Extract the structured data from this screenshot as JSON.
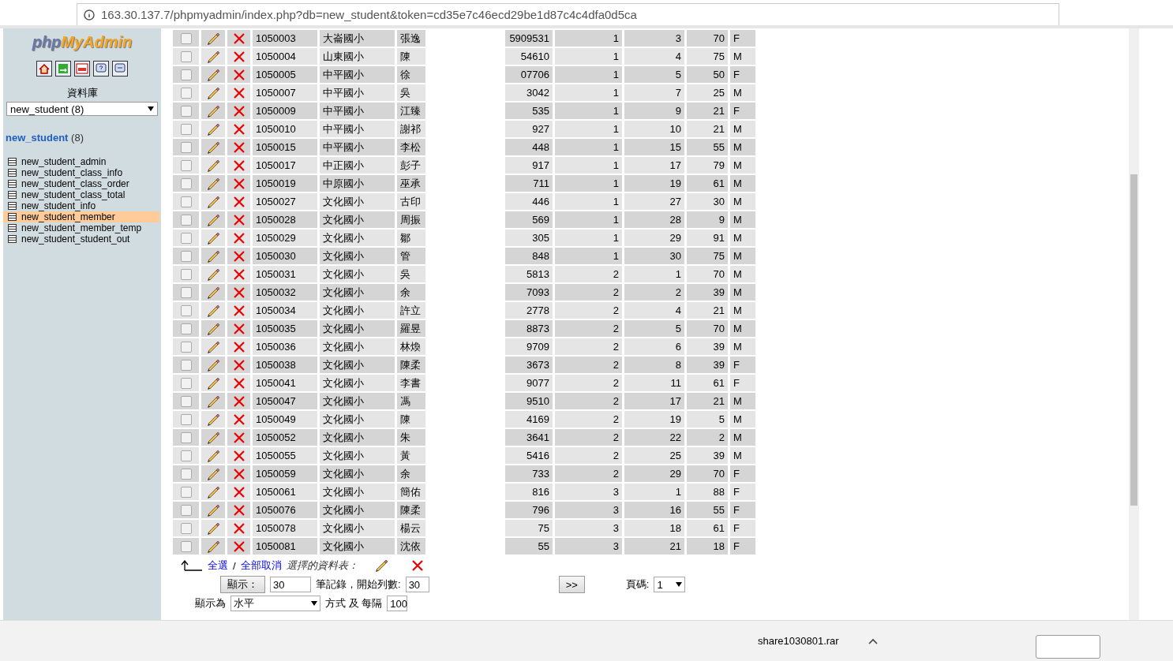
{
  "browser": {
    "address": "163.30.137.7/phpmyadmin/index.php?db=new_student&token=cd35e7c46ecd29be1d87c4c4dfa0d5ca"
  },
  "sidebar": {
    "logo": {
      "php": "php",
      "myadmin": "MyAdmin"
    },
    "database_label": "資料庫",
    "database_select": "new_student (8)",
    "database_link": {
      "name": "new_student",
      "count": "(8)"
    },
    "tables": [
      {
        "name": "new_student_admin",
        "selected": false
      },
      {
        "name": "new_student_class_info",
        "selected": false
      },
      {
        "name": "new_student_class_order",
        "selected": false
      },
      {
        "name": "new_student_class_total",
        "selected": false
      },
      {
        "name": "new_student_info",
        "selected": false
      },
      {
        "name": "new_student_member",
        "selected": true
      },
      {
        "name": "new_student_member_temp",
        "selected": false
      },
      {
        "name": "new_student_student_out",
        "selected": false
      }
    ]
  },
  "rows": [
    {
      "checked": false,
      "id": "1050003",
      "school": "大崙國小",
      "name": "張逸",
      "phone": "5909531",
      "class": "1",
      "seat": "3",
      "score": "70",
      "gender": "F"
    },
    {
      "checked": false,
      "id": "1050004",
      "school": "山東國小",
      "name": "陳",
      "phone": "54610",
      "class": "1",
      "seat": "4",
      "score": "75",
      "gender": "M"
    },
    {
      "checked": false,
      "id": "1050005",
      "school": "中平國小",
      "name": "徐",
      "phone": "07706",
      "class": "1",
      "seat": "5",
      "score": "50",
      "gender": "F"
    },
    {
      "checked": false,
      "id": "1050007",
      "school": "中平國小",
      "name": "吳",
      "phone": "3042",
      "class": "1",
      "seat": "7",
      "score": "25",
      "gender": "M"
    },
    {
      "checked": false,
      "id": "1050009",
      "school": "中平國小",
      "name": "江臻",
      "phone": "535",
      "class": "1",
      "seat": "9",
      "score": "21",
      "gender": "F"
    },
    {
      "checked": false,
      "id": "1050010",
      "school": "中平國小",
      "name": "謝祁",
      "phone": "927",
      "class": "1",
      "seat": "10",
      "score": "21",
      "gender": "M"
    },
    {
      "checked": false,
      "id": "1050015",
      "school": "中平國小",
      "name": "李松",
      "phone": "448",
      "class": "1",
      "seat": "15",
      "score": "55",
      "gender": "M"
    },
    {
      "checked": false,
      "id": "1050017",
      "school": "中正國小",
      "name": "彭子",
      "phone": "917",
      "class": "1",
      "seat": "17",
      "score": "79",
      "gender": "M"
    },
    {
      "checked": false,
      "id": "1050019",
      "school": "中原國小",
      "name": "巫承",
      "phone": "711",
      "class": "1",
      "seat": "19",
      "score": "61",
      "gender": "M"
    },
    {
      "checked": false,
      "id": "1050027",
      "school": "文化國小",
      "name": "古印",
      "phone": "446",
      "class": "1",
      "seat": "27",
      "score": "30",
      "gender": "M"
    },
    {
      "checked": false,
      "id": "1050028",
      "school": "文化國小",
      "name": "周振",
      "phone": "569",
      "class": "1",
      "seat": "28",
      "score": "9",
      "gender": "M"
    },
    {
      "checked": false,
      "id": "1050029",
      "school": "文化國小",
      "name": "鄒",
      "phone": "305",
      "class": "1",
      "seat": "29",
      "score": "91",
      "gender": "M"
    },
    {
      "checked": false,
      "id": "1050030",
      "school": "文化國小",
      "name": "管",
      "phone": "848",
      "class": "1",
      "seat": "30",
      "score": "75",
      "gender": "M"
    },
    {
      "checked": false,
      "id": "1050031",
      "school": "文化國小",
      "name": "吳",
      "phone": "5813",
      "class": "2",
      "seat": "1",
      "score": "70",
      "gender": "M"
    },
    {
      "checked": false,
      "id": "1050032",
      "school": "文化國小",
      "name": "余",
      "phone": "7093",
      "class": "2",
      "seat": "2",
      "score": "39",
      "gender": "M"
    },
    {
      "checked": false,
      "id": "1050034",
      "school": "文化國小",
      "name": "許立",
      "phone": "2778",
      "class": "2",
      "seat": "4",
      "score": "21",
      "gender": "M"
    },
    {
      "checked": false,
      "id": "1050035",
      "school": "文化國小",
      "name": "羅昱",
      "phone": "8873",
      "class": "2",
      "seat": "5",
      "score": "70",
      "gender": "M"
    },
    {
      "checked": false,
      "id": "1050036",
      "school": "文化國小",
      "name": "林煥",
      "phone": "9709",
      "class": "2",
      "seat": "6",
      "score": "39",
      "gender": "M"
    },
    {
      "checked": false,
      "id": "1050038",
      "school": "文化國小",
      "name": "陳柔",
      "phone": "3673",
      "class": "2",
      "seat": "8",
      "score": "39",
      "gender": "F"
    },
    {
      "checked": false,
      "id": "1050041",
      "school": "文化國小",
      "name": "李書",
      "phone": "9077",
      "class": "2",
      "seat": "11",
      "score": "61",
      "gender": "F"
    },
    {
      "checked": false,
      "id": "1050047",
      "school": "文化國小",
      "name": "馮",
      "phone": "9510",
      "class": "2",
      "seat": "17",
      "score": "21",
      "gender": "M"
    },
    {
      "checked": false,
      "id": "1050049",
      "school": "文化國小",
      "name": "陳",
      "phone": "4169",
      "class": "2",
      "seat": "19",
      "score": "5",
      "gender": "M"
    },
    {
      "checked": false,
      "id": "1050052",
      "school": "文化國小",
      "name": "朱",
      "phone": "3641",
      "class": "2",
      "seat": "22",
      "score": "2",
      "gender": "M"
    },
    {
      "checked": false,
      "id": "1050055",
      "school": "文化國小",
      "name": "黃",
      "phone": "5416",
      "class": "2",
      "seat": "25",
      "score": "39",
      "gender": "M"
    },
    {
      "checked": false,
      "id": "1050059",
      "school": "文化國小",
      "name": "余",
      "phone": "733",
      "class": "2",
      "seat": "29",
      "score": "70",
      "gender": "F"
    },
    {
      "checked": false,
      "id": "1050061",
      "school": "文化國小",
      "name": "簡佑",
      "phone": "816",
      "class": "3",
      "seat": "1",
      "score": "88",
      "gender": "F"
    },
    {
      "checked": false,
      "id": "1050076",
      "school": "文化國小",
      "name": "陳柔",
      "phone": "796",
      "class": "3",
      "seat": "16",
      "score": "55",
      "gender": "F"
    },
    {
      "checked": false,
      "id": "1050078",
      "school": "文化國小",
      "name": "楊云",
      "phone": "75",
      "class": "3",
      "seat": "18",
      "score": "61",
      "gender": "F"
    },
    {
      "checked": false,
      "id": "1050081",
      "school": "文化國小",
      "name": "沈依",
      "phone": "55",
      "class": "3",
      "seat": "21",
      "score": "18",
      "gender": "F"
    }
  ],
  "footer": {
    "select_all": "全選",
    "separator": "/",
    "deselect_all": "全部取消",
    "with_selected": "選擇的資料表：",
    "show_button": "顯示：",
    "rows_value": "30",
    "records_label": "筆記錄，開始列數:",
    "start_value": "30",
    "next_button": ">>",
    "page_label": "頁碼:",
    "page_value": "1",
    "display_label": "顯示為",
    "mode_value": "水平",
    "mode_label": "方式 及 每隔",
    "repeat_value": "100"
  },
  "download_bar": {
    "file": "share1030801.rar"
  }
}
